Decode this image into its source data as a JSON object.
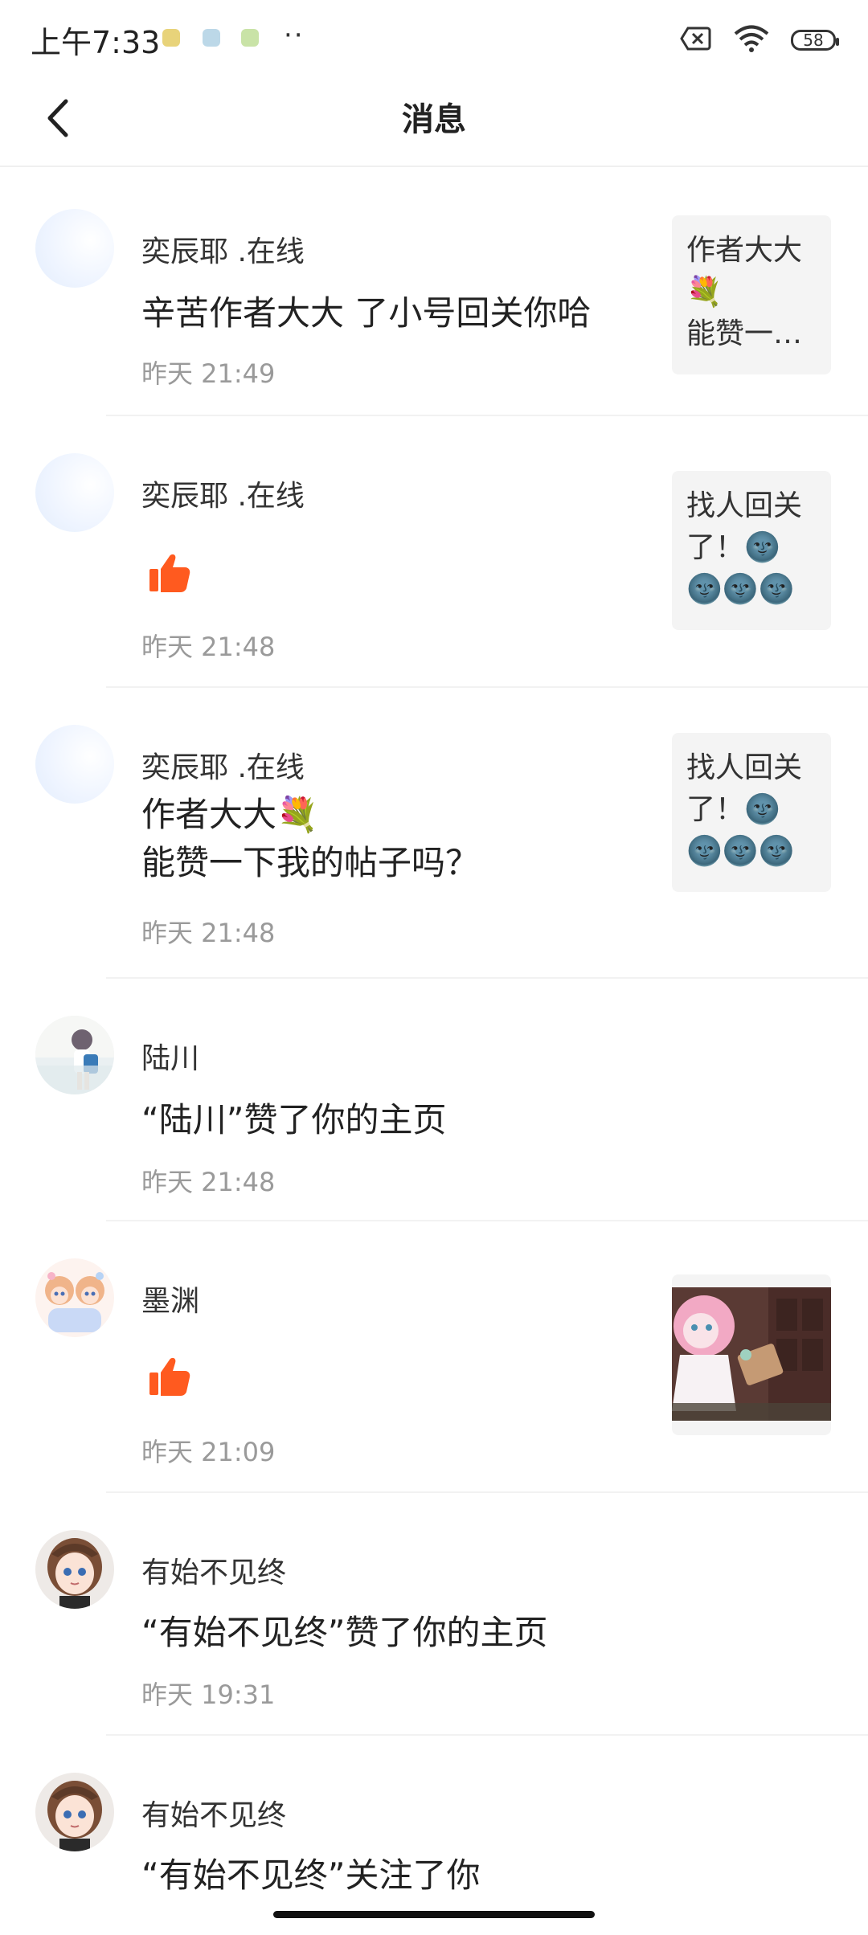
{
  "status_bar": {
    "time": "上午7:33",
    "dots": "··",
    "battery": "58",
    "icons": [
      "app-icon-1",
      "app-icon-2",
      "app-icon-3",
      "sim-off-icon",
      "wifi-icon",
      "battery-icon"
    ]
  },
  "header": {
    "title": "消息",
    "back_icon": "chevron-left-icon"
  },
  "messages": [
    {
      "name": "奕辰耶 .在线",
      "content": "辛苦作者大大 了小号回关你哈",
      "time": "昨天 21:49",
      "thumb_text": "作者大大\n💐\n能赞一…"
    },
    {
      "name": "奕辰耶 .在线",
      "content_icon": "thumbs-up-icon",
      "time": "昨天 21:48",
      "thumb_text": "找人回关\n了！🌚\n🌚🌚🌚"
    },
    {
      "name": "奕辰耶 .在线",
      "content": "作者大大💐\n能赞一下我的帖子吗？",
      "time": "昨天 21:48",
      "thumb_text": "找人回关\n了！🌚\n🌚🌚🌚"
    },
    {
      "name": "陆川",
      "content": "“陆川”赞了你的主页",
      "time": "昨天 21:48"
    },
    {
      "name": "墨渊",
      "content_icon": "thumbs-up-icon",
      "time": "昨天 21:09",
      "thumb_image": "anime-girl-photo-thumbnail"
    },
    {
      "name": "有始不见终",
      "content": "“有始不见终”赞了你的主页",
      "time": "昨天 19:31"
    },
    {
      "name": "有始不见终",
      "content": "“有始不见终”关注了你"
    }
  ],
  "colors": {
    "like_orange": "#ff5a1f",
    "time_gray": "#9a9a9a",
    "thumb_bg": "#f4f4f4"
  }
}
